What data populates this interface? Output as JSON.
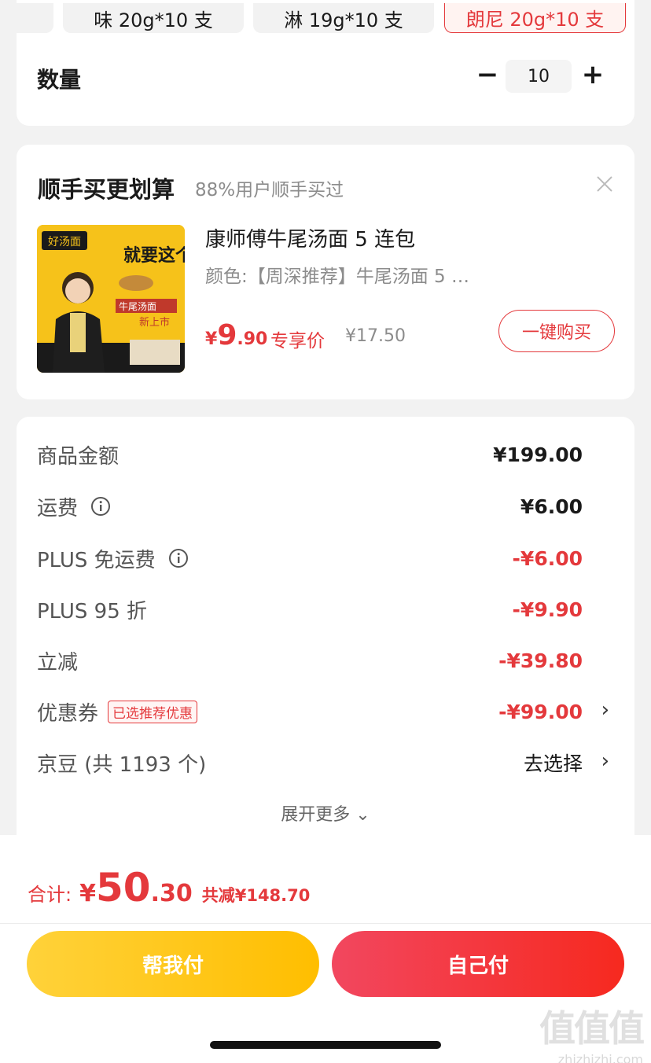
{
  "variants": [
    {
      "label": "味 20g*10 支",
      "selected": false
    },
    {
      "label": "淋 19g*10 支",
      "selected": false
    },
    {
      "label": "朗尼 20g*10 支",
      "selected": true
    }
  ],
  "quantity": {
    "label": "数量",
    "minus": "−",
    "value": "10",
    "plus": "+"
  },
  "addon": {
    "title": "顺手买更划算",
    "subtitle": "88%用户顺手买过",
    "close_icon": "close-icon",
    "product": {
      "name": "康师傅牛尾汤面 5 连包",
      "variant": "颜色:【周深推荐】牛尾汤面 5 …",
      "price_yen": "¥",
      "price_int": "9",
      "price_dec": ".90",
      "price_tag": "专享价",
      "original_price": "¥17.50",
      "buy_label": "一键购买",
      "thumb_text": {
        "brand": "好汤面",
        "slogan": "就要这个汤",
        "pack": "牛尾汤面",
        "new": "新上市"
      }
    }
  },
  "summary": {
    "rows": [
      {
        "label": "商品金额",
        "value": "¥199.00",
        "red": false,
        "info": false
      },
      {
        "label": "运费",
        "value": "¥6.00",
        "red": false,
        "info": true
      },
      {
        "label": "PLUS 免运费",
        "value": "-¥6.00",
        "red": true,
        "info": true
      },
      {
        "label": "PLUS 95 折",
        "value": "-¥9.90",
        "red": true,
        "info": false
      },
      {
        "label": "立减",
        "value": "-¥39.80",
        "red": true,
        "info": false
      },
      {
        "label": "优惠券",
        "value": "-¥99.00",
        "red": true,
        "badge": "已选推荐优惠"
      },
      {
        "label": "京豆 (共 1193 个)",
        "value": "去选择",
        "red": false
      }
    ],
    "chevron": "›",
    "expand_label": "展开更多 ⌄"
  },
  "footer": {
    "total_label": "合计:",
    "total_yen": "¥",
    "total_int": "50",
    "total_dec": ".30",
    "saved": "共减¥148.70",
    "help_pay": "帮我付",
    "self_pay": "自己付"
  },
  "watermark": {
    "logo": "值值值",
    "site": "zhizhizhi.com"
  },
  "colors": {
    "accent": "#e4393c",
    "yellow": "#ffc51a",
    "red_btn": "#f6291f"
  }
}
